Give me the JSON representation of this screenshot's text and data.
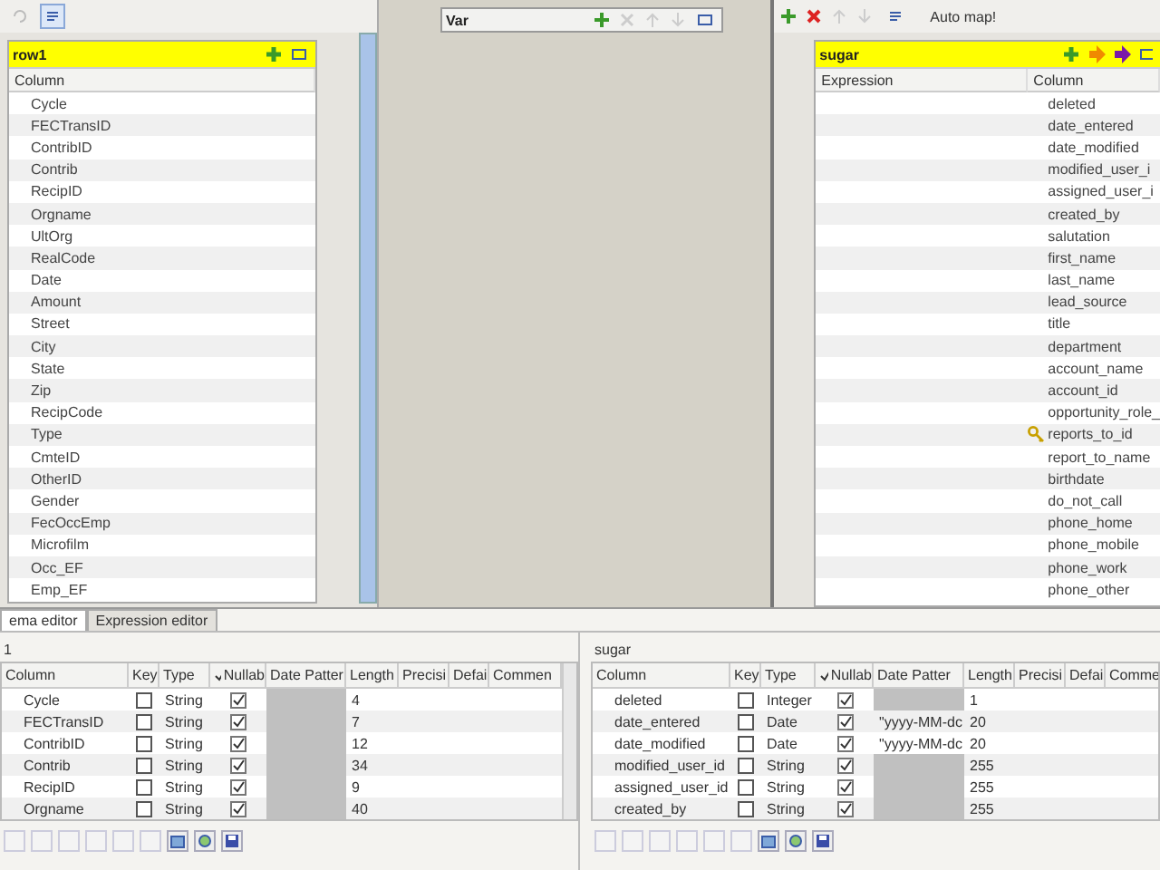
{
  "input_table": {
    "title": "row1",
    "header": "Column",
    "rows": [
      "Cycle",
      "FECTransID",
      "ContribID",
      "Contrib",
      "RecipID",
      "Orgname",
      "UltOrg",
      "RealCode",
      "Date",
      "Amount",
      "Street",
      "City",
      "State",
      "Zip",
      "RecipCode",
      "Type",
      "CmteID",
      "OtherID",
      "Gender",
      "FecOccEmp",
      "Microfilm",
      "Occ_EF",
      "Emp_EF"
    ]
  },
  "var_table": {
    "title": "Var"
  },
  "output_toolbar": {
    "automap": "Auto map!"
  },
  "output_table": {
    "title": "sugar",
    "columns": [
      "Expression",
      "Column"
    ],
    "rows": [
      {
        "name": "deleted",
        "key": false
      },
      {
        "name": "date_entered",
        "key": false
      },
      {
        "name": "date_modified",
        "key": false
      },
      {
        "name": "modified_user_i",
        "key": false
      },
      {
        "name": "assigned_user_i",
        "key": false
      },
      {
        "name": "created_by",
        "key": false
      },
      {
        "name": "salutation",
        "key": false
      },
      {
        "name": "first_name",
        "key": false
      },
      {
        "name": "last_name",
        "key": false
      },
      {
        "name": "lead_source",
        "key": false
      },
      {
        "name": "title",
        "key": false
      },
      {
        "name": "department",
        "key": false
      },
      {
        "name": "account_name",
        "key": false
      },
      {
        "name": "account_id",
        "key": false
      },
      {
        "name": "opportunity_role_",
        "key": false
      },
      {
        "name": "reports_to_id",
        "key": true
      },
      {
        "name": "report_to_name",
        "key": false
      },
      {
        "name": "birthdate",
        "key": false
      },
      {
        "name": "do_not_call",
        "key": false
      },
      {
        "name": "phone_home",
        "key": false
      },
      {
        "name": "phone_mobile",
        "key": false
      },
      {
        "name": "phone_work",
        "key": false
      },
      {
        "name": "phone_other",
        "key": false
      }
    ]
  },
  "tabs": [
    {
      "label": "ema editor",
      "selected": true
    },
    {
      "label": "Expression editor",
      "selected": false
    }
  ],
  "schemas": [
    {
      "title": "1",
      "columns": [
        "Column",
        "Key",
        "Type",
        "Nullab",
        "Date Patter",
        "Length",
        "Precisi",
        "Defai",
        "Commen"
      ],
      "rows": [
        {
          "column": "Cycle",
          "key": false,
          "type": "String",
          "nullable": true,
          "length": "4"
        },
        {
          "column": "FECTransID",
          "key": false,
          "type": "String",
          "nullable": true,
          "length": "7"
        },
        {
          "column": "ContribID",
          "key": false,
          "type": "String",
          "nullable": true,
          "length": "12"
        },
        {
          "column": "Contrib",
          "key": false,
          "type": "String",
          "nullable": true,
          "length": "34"
        },
        {
          "column": "RecipID",
          "key": false,
          "type": "String",
          "nullable": true,
          "length": "9"
        },
        {
          "column": "Orgname",
          "key": false,
          "type": "String",
          "nullable": true,
          "length": "40"
        }
      ]
    },
    {
      "title": "sugar",
      "columns": [
        "Column",
        "Key",
        "Type",
        "Nullab",
        "Date Patter",
        "Length",
        "Precisi",
        "Defai",
        "Comme"
      ],
      "rows": [
        {
          "column": "deleted",
          "key": false,
          "type": "Integer",
          "nullable": true,
          "length": "1"
        },
        {
          "column": "date_entered",
          "key": false,
          "type": "Date",
          "nullable": true,
          "date_pattern": "\"yyyy-MM-dc",
          "length": "20"
        },
        {
          "column": "date_modified",
          "key": false,
          "type": "Date",
          "nullable": true,
          "date_pattern": "\"yyyy-MM-dc",
          "length": "20"
        },
        {
          "column": "modified_user_id",
          "key": false,
          "type": "String",
          "nullable": true,
          "length": "255"
        },
        {
          "column": "assigned_user_id",
          "key": false,
          "type": "String",
          "nullable": true,
          "length": "255"
        },
        {
          "column": "created_by",
          "key": false,
          "type": "String",
          "nullable": true,
          "length": "255"
        }
      ]
    }
  ]
}
